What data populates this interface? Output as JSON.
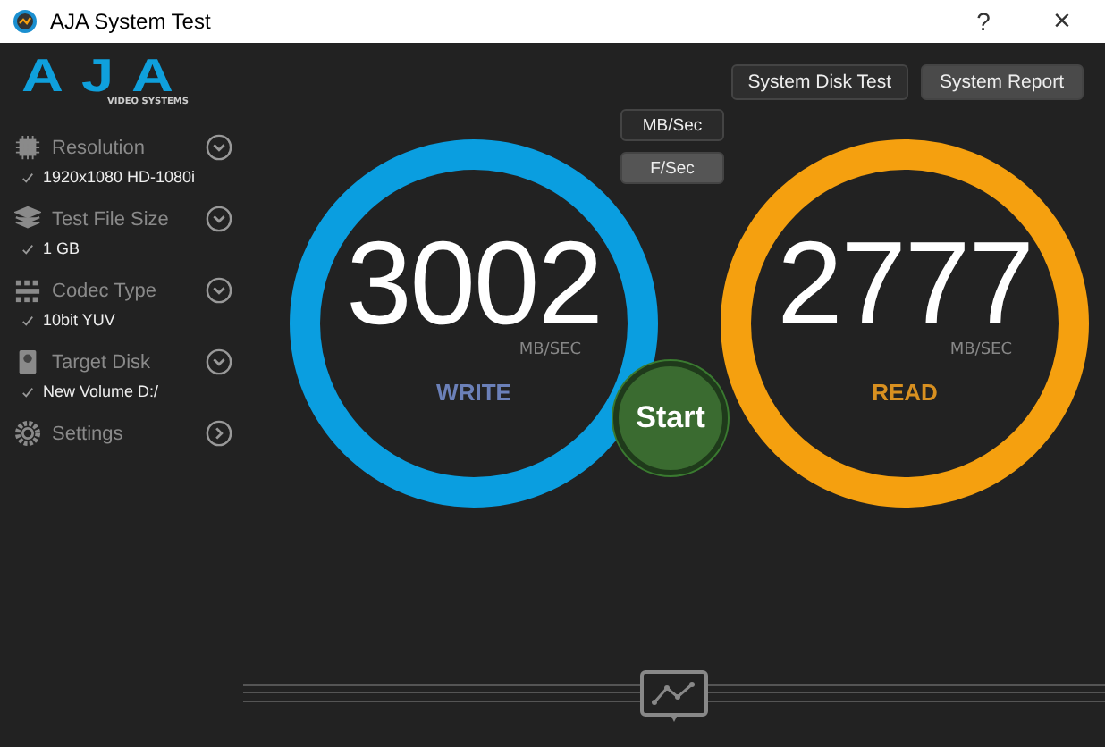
{
  "window": {
    "title": "AJA System Test",
    "help": "?",
    "close": "×"
  },
  "logo": {
    "brand": "AJA",
    "tagline": "VIDEO SYSTEMS"
  },
  "sidebar": {
    "items": [
      {
        "kind": "resolution",
        "label": "Resolution",
        "expanded": false,
        "value": "1920x1080 HD-1080i"
      },
      {
        "kind": "filesize",
        "label": "Test File Size",
        "expanded": false,
        "value": "1 GB"
      },
      {
        "kind": "codec",
        "label": "Codec Type",
        "expanded": false,
        "value": "10bit YUV"
      },
      {
        "kind": "disk",
        "label": "Target Disk",
        "expanded": false,
        "value": "New Volume D:/"
      },
      {
        "kind": "settings",
        "label": "Settings",
        "expanded": false
      }
    ]
  },
  "top_buttons": [
    "System Disk Test",
    "System Report"
  ],
  "units": [
    {
      "label": "MB/Sec",
      "selected": true
    },
    {
      "label": "F/Sec",
      "selected": false
    }
  ],
  "gauges": [
    {
      "kind": "write",
      "value": "3002",
      "unit": "MB/SEC",
      "label": "WRITE",
      "color": "#0a9ee0"
    },
    {
      "kind": "read",
      "value": "2777",
      "unit": "MB/SEC",
      "label": "READ",
      "color": "#f5a00f"
    }
  ],
  "start_button": "Start"
}
